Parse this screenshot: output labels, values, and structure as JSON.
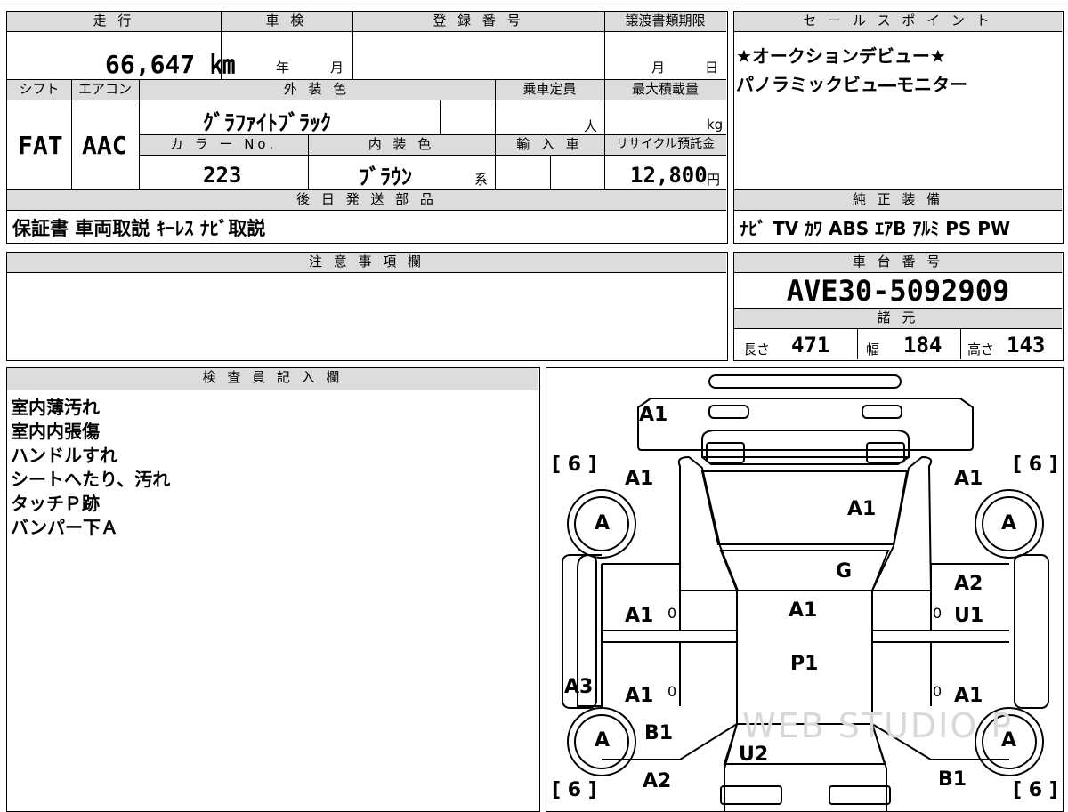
{
  "summary": {
    "headers": {
      "mileage": "走 行",
      "inspection": "車 検",
      "registration": "登 録 番 号",
      "transfer_deadline": "譲渡書類期限",
      "shift": "シフト",
      "aircon": "エアコン",
      "exterior_color": "外 装 色",
      "capacity": "乗車定員",
      "max_load": "最大積載量",
      "color_no": "カ ラ ー No.",
      "interior_color": "内 装 色",
      "import": "輸 入 車",
      "recycle_fee": "リサイクル預託金",
      "later_parts": "後 日 発 送 部 品"
    },
    "mileage_value": "66,647 ㎞",
    "inspection_year_unit": "年",
    "inspection_month_unit": "月",
    "transfer_month_unit": "月",
    "transfer_day_unit": "日",
    "shift_value": "FAT",
    "aircon_value": "AAC",
    "exterior_color_value": "ｸﾞﾗﾌｧｲﾄﾌﾞﾗｯｸ",
    "capacity_unit": "人",
    "max_load_unit": "kg",
    "color_no_value": "223",
    "interior_color_value": "ﾌﾞﾗｳﾝ",
    "interior_color_suffix": "系",
    "recycle_fee_value": "12,800",
    "recycle_fee_unit": "円",
    "later_parts_value": "保証書 車両取説 ｷｰﾚｽ ﾅﾋﾞ取説"
  },
  "sales_points": {
    "header": "セ ー ル ス ポ イ ン ト",
    "lines": [
      "★オークションデビュー★",
      "パノラミックビュ―モニター"
    ]
  },
  "standard_equipment": {
    "header": "純 正 装 備",
    "value": "ﾅﾋﾞ TV ｶﾜ ABS ｴｱB ｱﾙﾐ PS PW"
  },
  "notes": {
    "header": "注 意 事 項 欄",
    "value": ""
  },
  "chassis": {
    "header": "車 台 番 号",
    "value": "AVE30-5092909",
    "spec_header": "諸 元",
    "length_label": "長さ",
    "length_value": "471",
    "width_label": "幅",
    "width_value": "184",
    "height_label": "高さ",
    "height_value": "143"
  },
  "inspector": {
    "header": "検 査 員 記 入 欄",
    "lines": [
      "室内薄汚れ",
      "室内内張傷",
      "ハンドルすれ",
      "シートへたり、汚れ",
      "タッチＰ跡",
      "バンパー下Ａ"
    ]
  },
  "diagram": {
    "watermark": "WEB STUDIO P",
    "tires": {
      "front_left_depth": "6",
      "front_right_depth": "6",
      "rear_left_depth": "6",
      "rear_right_depth": "6",
      "wheel_label": "A"
    },
    "damage": {
      "front_bumper": "A1",
      "front_left_fender": "A1",
      "front_right_fender": "A1",
      "hood": "A1",
      "windshield": "G",
      "front_right_door_upper": "A2",
      "front_right_door": "U1",
      "front_left_door": "A1",
      "roof": "A1",
      "roof_rear": "P1",
      "left_sill": "A3",
      "rear_left_door": "A1",
      "rear_right_door": "A1",
      "rear_left_fender": "B1",
      "rear_left_quarter": "A2",
      "trunk": "U2",
      "rear_right_quarter": "B1",
      "left_front_door_mark": "0",
      "left_rear_door_mark": "0",
      "right_front_door_mark": "0",
      "right_rear_door_mark": "0"
    }
  }
}
